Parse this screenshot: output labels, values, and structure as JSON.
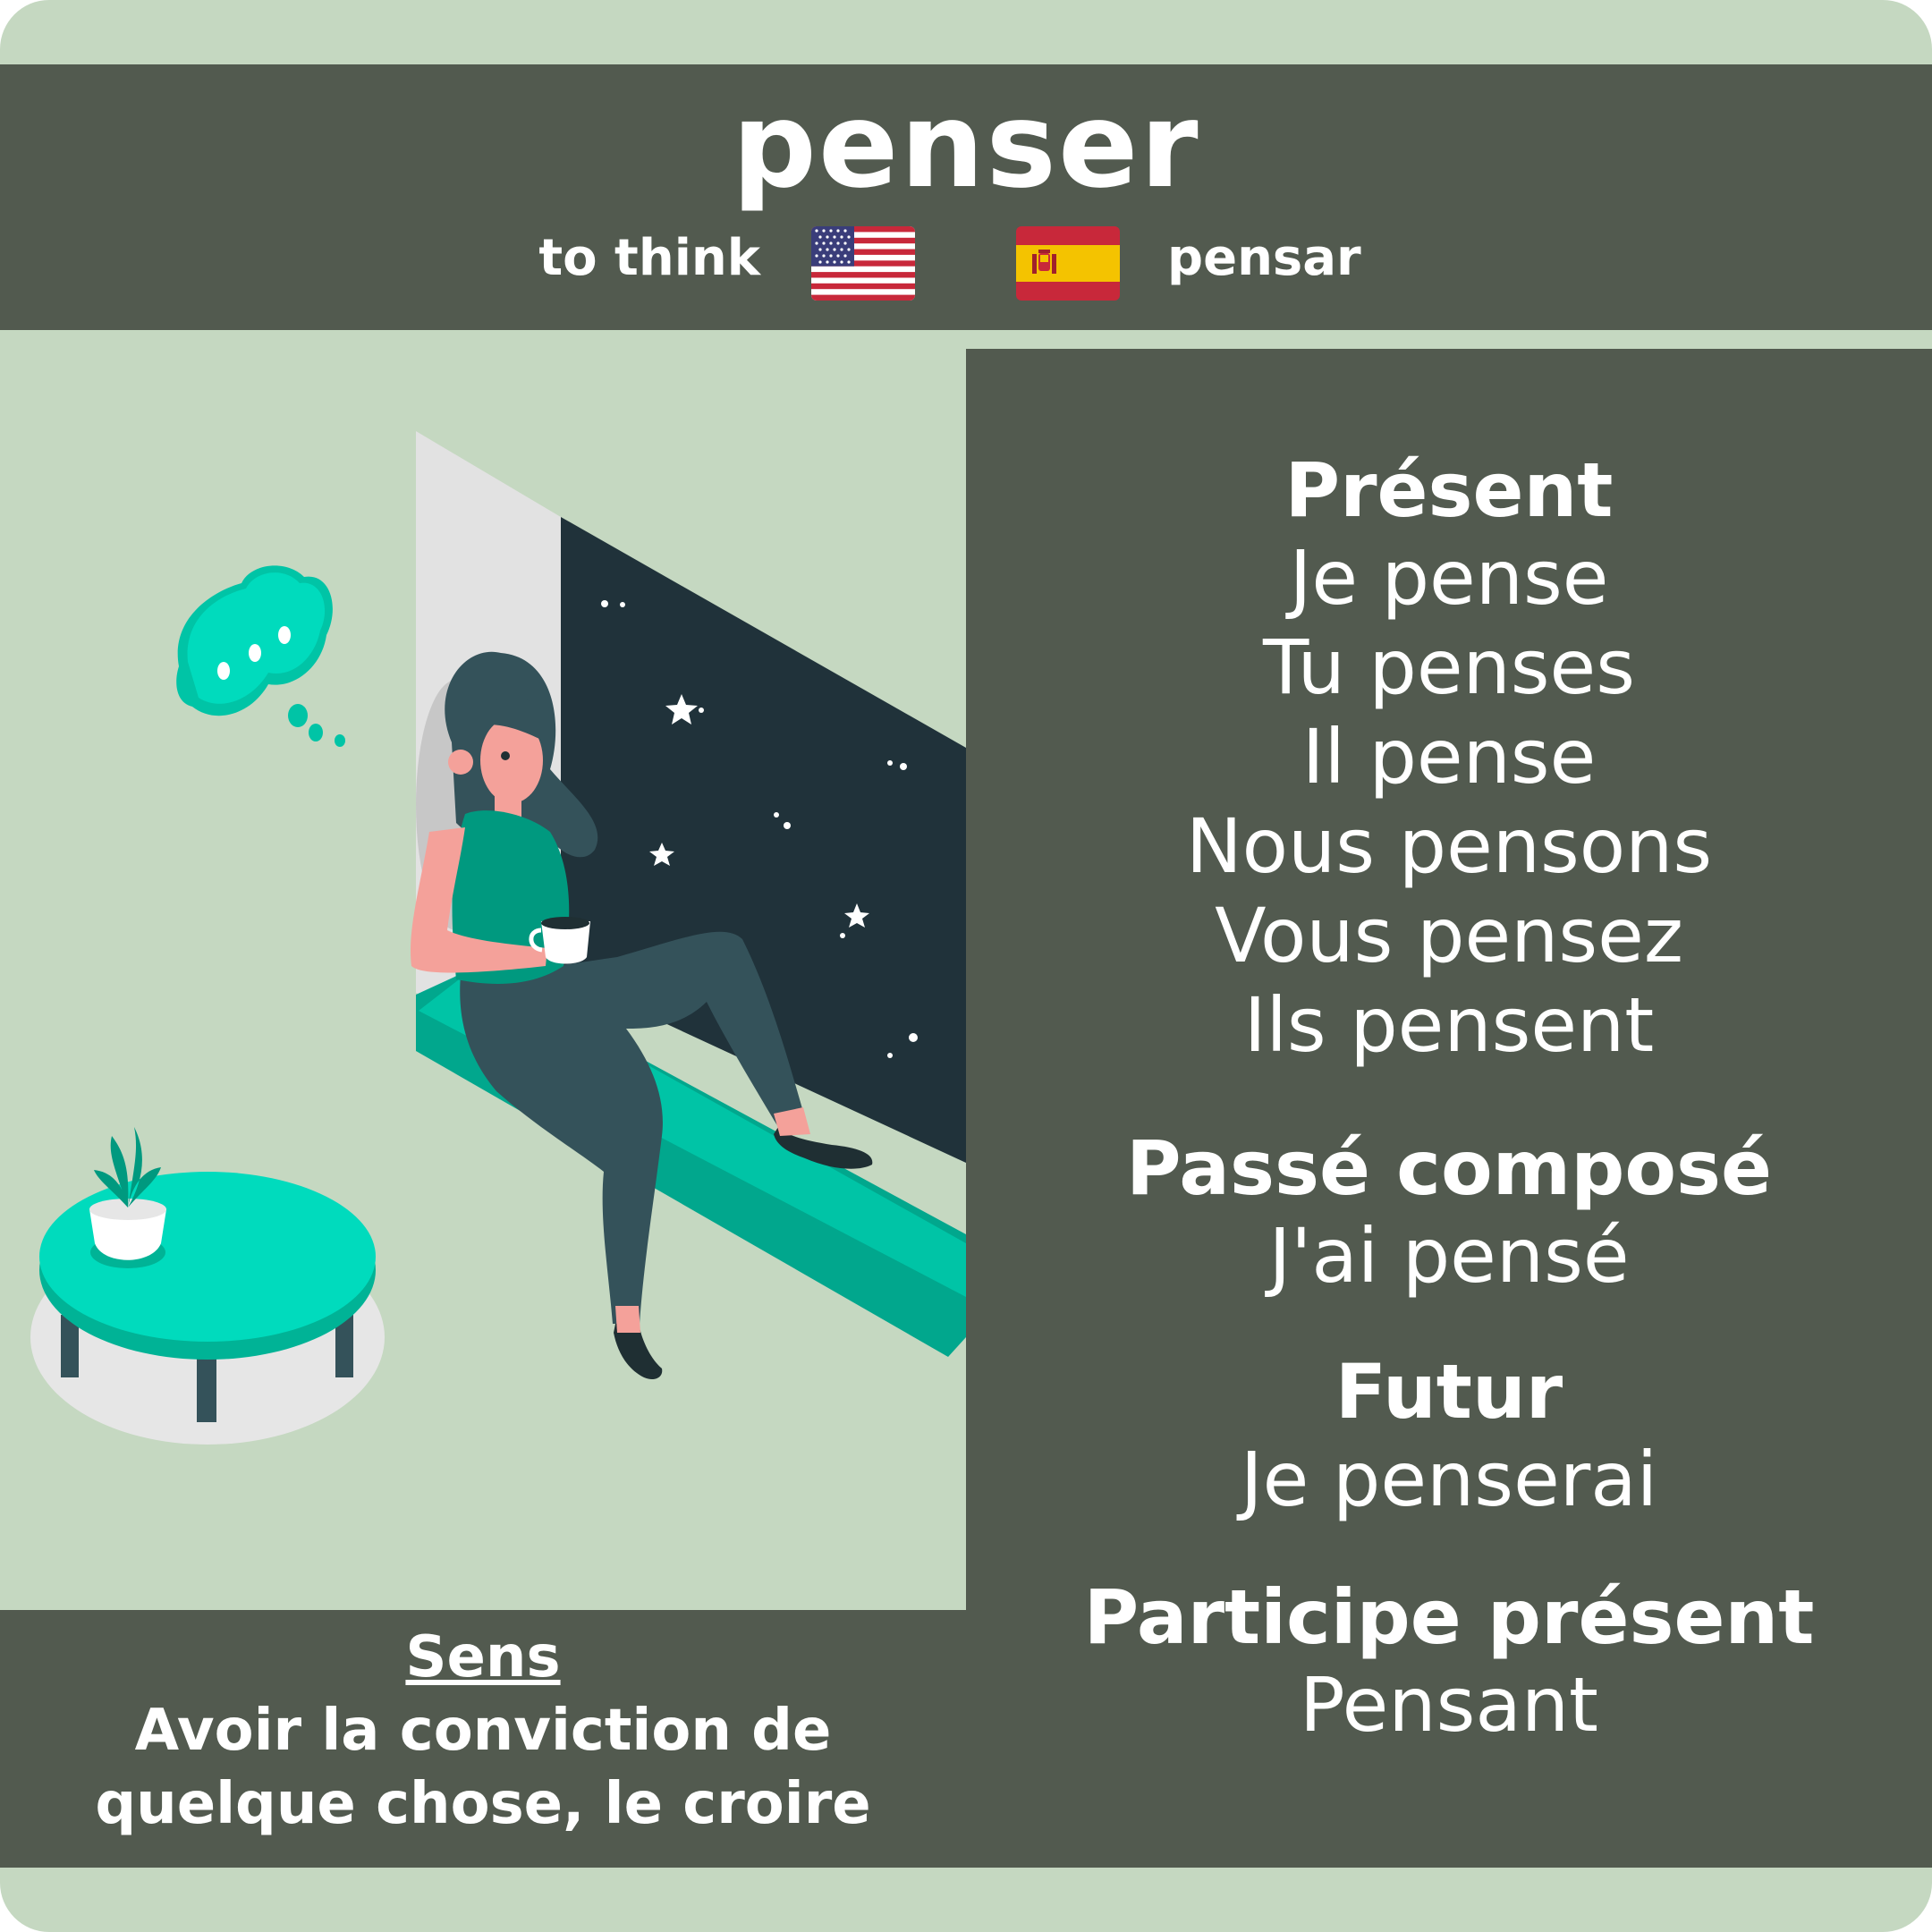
{
  "verb": "penser",
  "translations": {
    "english": "to think",
    "spanish": "pensar",
    "english_flag": "us-flag-icon",
    "spanish_flag": "es-flag-icon"
  },
  "tenses": {
    "present": {
      "heading": "Présent",
      "forms": [
        "Je pense",
        "Tu penses",
        "Il pense",
        "Nous pensons",
        "Vous pensez",
        "Ils pensent"
      ]
    },
    "passe_compose": {
      "heading": "Passé composé",
      "form": "J'ai pensé"
    },
    "futur": {
      "heading": "Futur",
      "form": "Je penserai"
    },
    "participe_present": {
      "heading": "Participe présent",
      "form": "Pensant"
    }
  },
  "meaning": {
    "label": "Sens",
    "lines": [
      "Avoir la conviction de",
      "quelque chose, le croire"
    ]
  },
  "colors": {
    "background": "#c5d8c1",
    "panel": "#525a4f",
    "accent": "#00c9a7",
    "night_sky": "#20323a"
  }
}
